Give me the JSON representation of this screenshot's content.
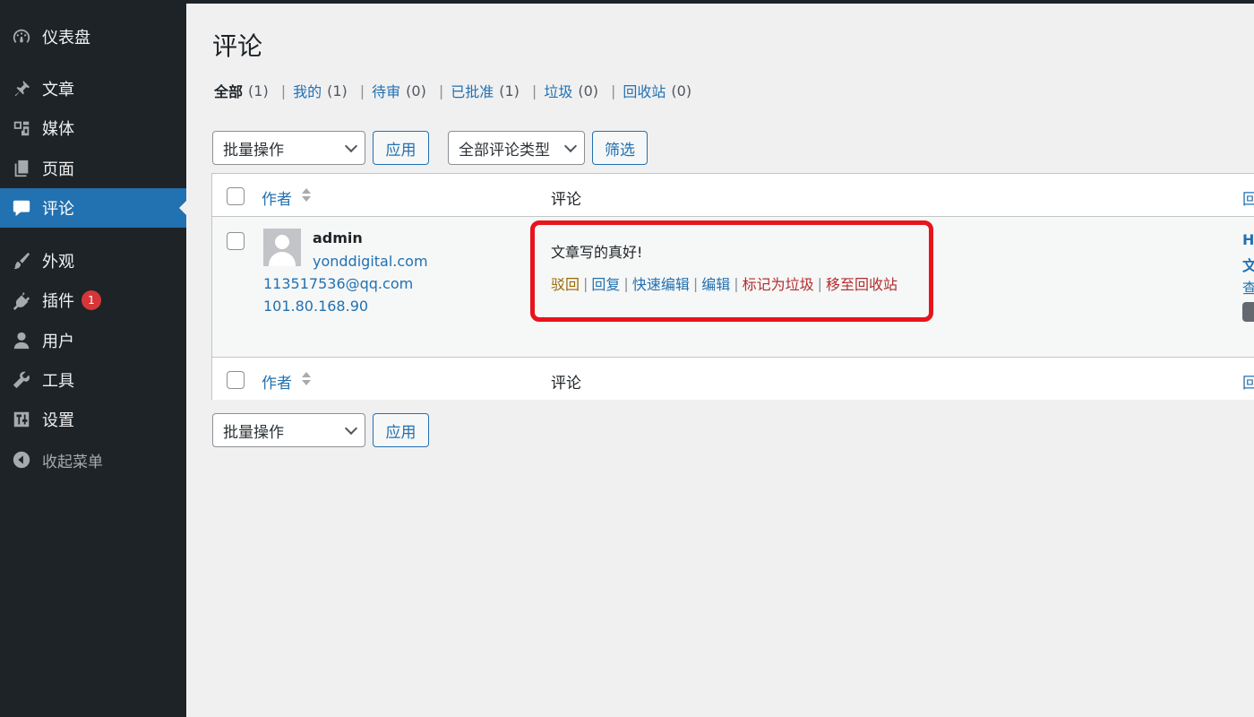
{
  "sidebar": {
    "items": [
      {
        "label": "仪表盘",
        "icon": "dashboard-icon"
      },
      {
        "label": "文章",
        "icon": "pin-icon"
      },
      {
        "label": "媒体",
        "icon": "media-icon"
      },
      {
        "label": "页面",
        "icon": "page-icon"
      },
      {
        "label": "评论",
        "icon": "comment-icon",
        "active": true
      },
      {
        "label": "外观",
        "icon": "brush-icon"
      },
      {
        "label": "插件",
        "icon": "plugin-icon",
        "badge": "1"
      },
      {
        "label": "用户",
        "icon": "user-icon"
      },
      {
        "label": "工具",
        "icon": "wrench-icon"
      },
      {
        "label": "设置",
        "icon": "settings-icon"
      },
      {
        "label": "收起菜单",
        "icon": "collapse-icon"
      }
    ]
  },
  "page": {
    "title": "评论"
  },
  "filters": [
    {
      "label": "全部",
      "count": "(1)",
      "current": true
    },
    {
      "label": "我的",
      "count": "(1)"
    },
    {
      "label": "待审",
      "count": "(0)"
    },
    {
      "label": "已批准",
      "count": "(1)"
    },
    {
      "label": "垃圾",
      "count": "(0)"
    },
    {
      "label": "回收站",
      "count": "(0)"
    }
  ],
  "filter_separator": "|",
  "toolbar": {
    "bulk_actions": "批量操作",
    "apply": "应用",
    "comment_type": "全部评论类型",
    "filter": "筛选"
  },
  "table": {
    "col_author": "作者",
    "col_comment": "评论",
    "col_response_partial": "回"
  },
  "comment": {
    "author_name": "admin",
    "author_url": "yonddigital.com",
    "author_email": "113517536@qq.com",
    "author_ip": "101.80.168.90",
    "text": "文章写的真好!",
    "actions": {
      "unapprove": "驳回",
      "reply": "回复",
      "quick_edit": "快速编辑",
      "edit": "编辑",
      "spam": "标记为垃圾",
      "trash": "移至回收站"
    },
    "action_separator": "|",
    "response_partial": [
      "H",
      "文",
      "查"
    ]
  },
  "colors": {
    "sidebar_bg": "#1d2327",
    "accent": "#2271b1",
    "highlight_border": "#e8141c",
    "badge": "#d63638"
  }
}
